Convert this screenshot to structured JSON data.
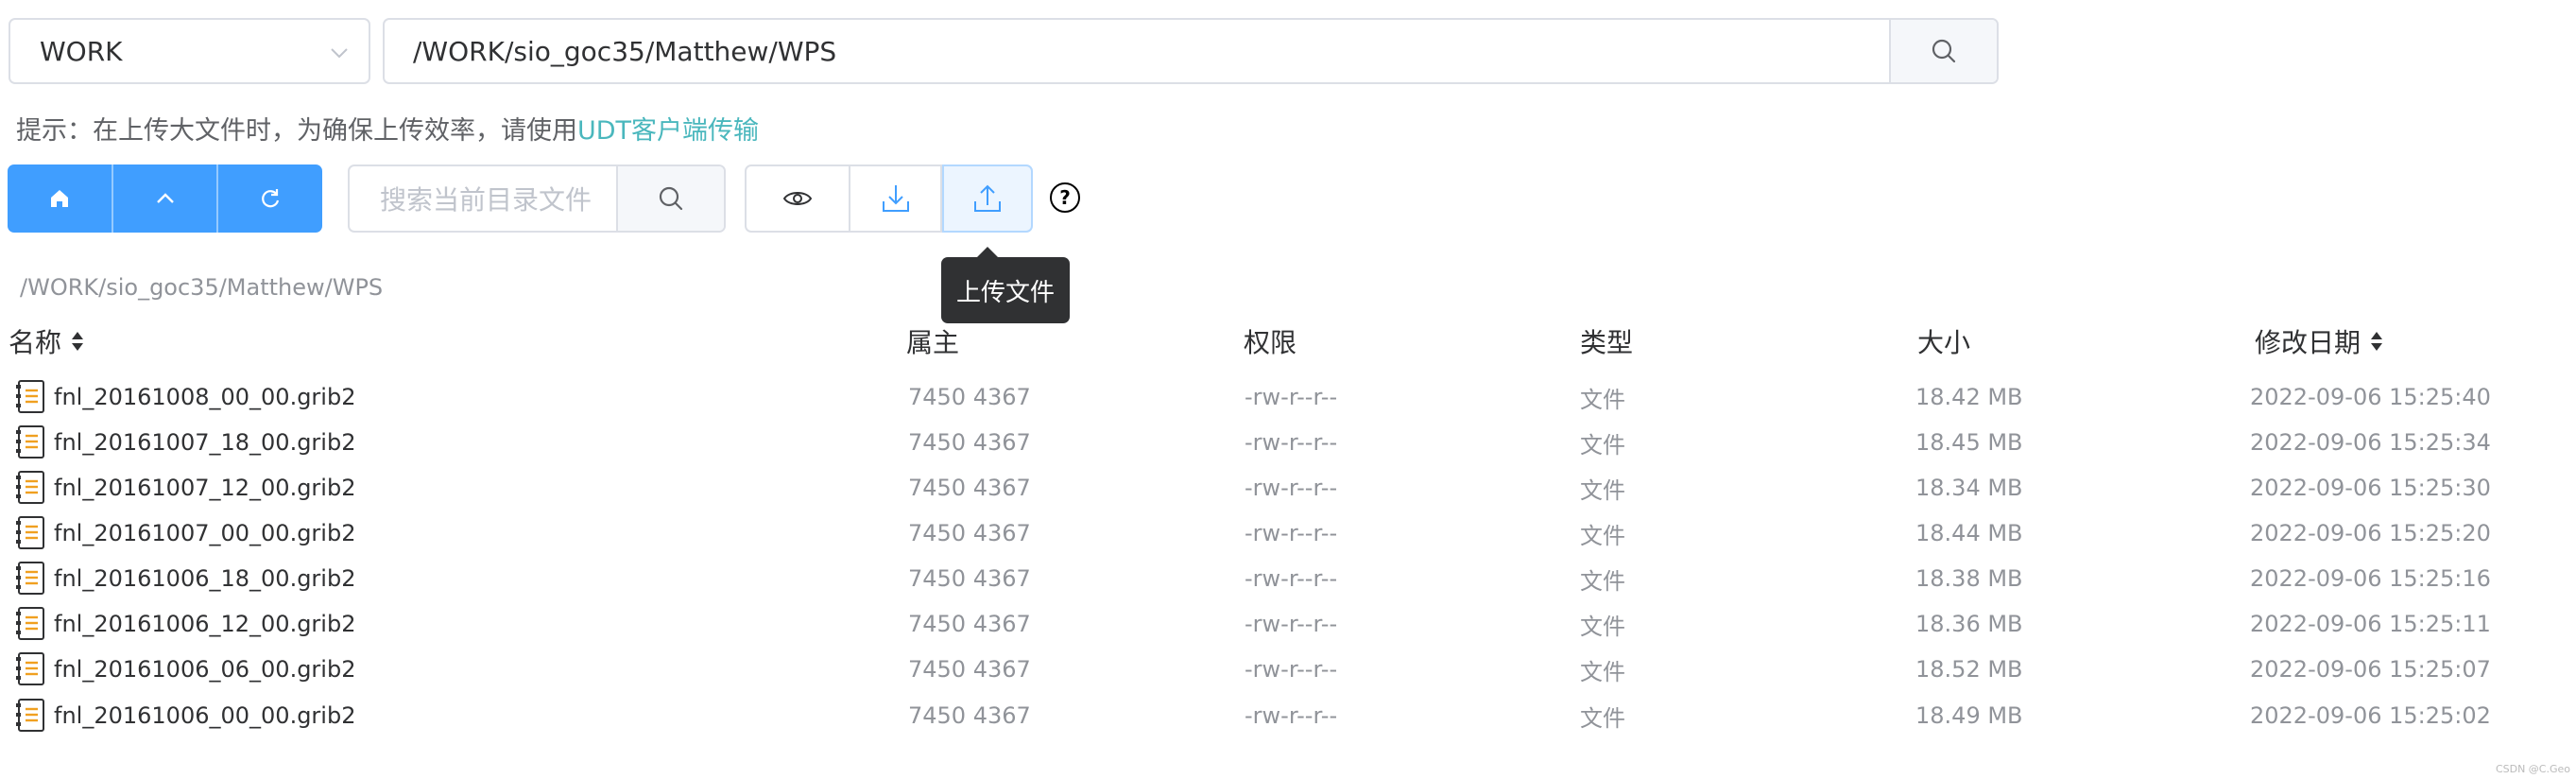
{
  "drive": {
    "selected": "WORK"
  },
  "path_bar": {
    "value": "/WORK/sio_goc35/Matthew/WPS"
  },
  "tip": {
    "prefix": "提示：在上传大文件时，为确保上传效率，请使用",
    "link": "UDT客户端传输"
  },
  "toolbar": {
    "search_placeholder": "搜索当前目录文件",
    "tooltip": "上传文件",
    "help_glyph": "?"
  },
  "current_path": "/WORK/sio_goc35/Matthew/WPS",
  "table": {
    "headers": {
      "name": "名称",
      "owner": "属主",
      "perm": "权限",
      "type": "类型",
      "size": "大小",
      "date": "修改日期"
    },
    "rows": [
      {
        "name": "fnl_20161008_00_00.grib2",
        "owner": "7450 4367",
        "perm": "-rw-r--r--",
        "type": "文件",
        "size": "18.42 MB",
        "date": "2022-09-06 15:25:40"
      },
      {
        "name": "fnl_20161007_18_00.grib2",
        "owner": "7450 4367",
        "perm": "-rw-r--r--",
        "type": "文件",
        "size": "18.45 MB",
        "date": "2022-09-06 15:25:34"
      },
      {
        "name": "fnl_20161007_12_00.grib2",
        "owner": "7450 4367",
        "perm": "-rw-r--r--",
        "type": "文件",
        "size": "18.34 MB",
        "date": "2022-09-06 15:25:30"
      },
      {
        "name": "fnl_20161007_00_00.grib2",
        "owner": "7450 4367",
        "perm": "-rw-r--r--",
        "type": "文件",
        "size": "18.44 MB",
        "date": "2022-09-06 15:25:20"
      },
      {
        "name": "fnl_20161006_18_00.grib2",
        "owner": "7450 4367",
        "perm": "-rw-r--r--",
        "type": "文件",
        "size": "18.38 MB",
        "date": "2022-09-06 15:25:16"
      },
      {
        "name": "fnl_20161006_12_00.grib2",
        "owner": "7450 4367",
        "perm": "-rw-r--r--",
        "type": "文件",
        "size": "18.36 MB",
        "date": "2022-09-06 15:25:11"
      },
      {
        "name": "fnl_20161006_06_00.grib2",
        "owner": "7450 4367",
        "perm": "-rw-r--r--",
        "type": "文件",
        "size": "18.52 MB",
        "date": "2022-09-06 15:25:07"
      },
      {
        "name": "fnl_20161006_00_00.grib2",
        "owner": "7450 4367",
        "perm": "-rw-r--r--",
        "type": "文件",
        "size": "18.49 MB",
        "date": "2022-09-06 15:25:02"
      }
    ]
  },
  "watermark": "CSDN @C.Geo",
  "colors": {
    "primary": "#409eff",
    "link": "#4ab7bd",
    "tooltip_bg": "#303133",
    "upload_active_bg": "#ecf5ff"
  }
}
